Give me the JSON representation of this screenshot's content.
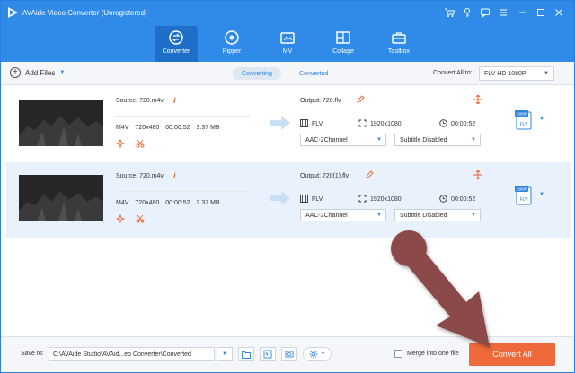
{
  "app": {
    "title": "AVAide Video Converter (Unregistered)"
  },
  "nav": {
    "tabs": [
      {
        "label": "Converter",
        "icon": "converter-icon",
        "active": true
      },
      {
        "label": "Ripper",
        "icon": "ripper-icon",
        "active": false
      },
      {
        "label": "MV",
        "icon": "mv-icon",
        "active": false
      },
      {
        "label": "Collage",
        "icon": "collage-icon",
        "active": false
      },
      {
        "label": "Toolbox",
        "icon": "toolbox-icon",
        "active": false
      }
    ]
  },
  "toolbar": {
    "add_files_label": "Add Files",
    "segments": [
      "Converting",
      "Converted"
    ],
    "convert_all_label": "Convert All to:",
    "convert_all_value": "FLV HD 1080P"
  },
  "files": [
    {
      "source": "Source: 720.m4v",
      "format": "M4V",
      "resolution": "720x480",
      "duration": "00:00:52",
      "size": "3.37 MB",
      "output": "Output: 720.flv",
      "out_format": "FLV",
      "out_resolution": "1920x1080",
      "out_duration": "00:00:52",
      "audio": "AAC-2Channel",
      "subtitle": "Subtitle Disabled",
      "badge_top": "1080P",
      "badge_bottom": "FLV"
    },
    {
      "source": "Source: 720.m4v",
      "format": "M4V",
      "resolution": "720x480",
      "duration": "00:00:52",
      "size": "3.37 MB",
      "output": "Output: 720(1).flv",
      "out_format": "FLV",
      "out_resolution": "1920x1080",
      "out_duration": "00:00:52",
      "audio": "AAC-2Channel",
      "subtitle": "Subtitle Disabled",
      "badge_top": "1080P",
      "badge_bottom": "FLV"
    }
  ],
  "bottom": {
    "save_to_label": "Save to:",
    "path": "C:\\AVAide Studio\\AVAid...eo Converter\\Converted",
    "merge_label": "Merge into one file",
    "convert_all_button": "Convert All"
  },
  "colors": {
    "accent": "#2f8ae8",
    "convert_button": "#ee6a3a",
    "overlay_arrow": "#8b4a4a"
  }
}
